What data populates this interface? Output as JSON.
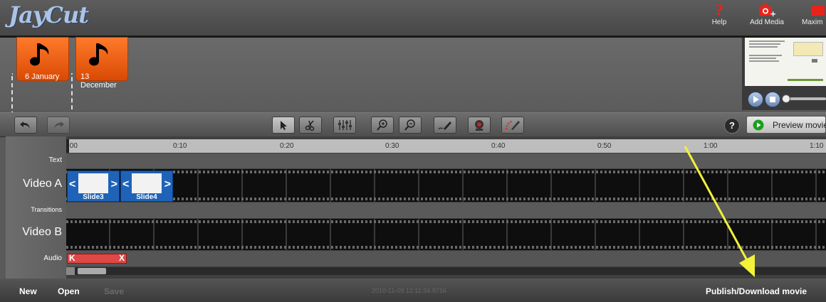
{
  "app": {
    "logo": "JayCut"
  },
  "header": {
    "help_label": "Help",
    "add_media_label": "Add Media",
    "maximize_label": "Maxim"
  },
  "media_bin": {
    "items": [
      {
        "label": "6 January",
        "icon": "music-note-icon"
      },
      {
        "label": "13 December",
        "icon": "music-note-icon"
      }
    ]
  },
  "toolbar": {
    "buttons": [
      "undo-icon",
      "redo-icon",
      "select-pointer-icon",
      "split-scissors-icon",
      "adjust-levels-icon",
      "zoom-in-icon",
      "zoom-out-icon",
      "pen-icon",
      "webcam-icon",
      "effects-brush-icon"
    ],
    "help_label": "?",
    "preview_label": "Preview movie"
  },
  "timeline": {
    "ticks": [
      ":00",
      "0:10",
      "0:20",
      "0:30",
      "0:40",
      "0:50",
      "1:00",
      "1:10"
    ],
    "tracks": {
      "text": "Text",
      "video_a": "Video A",
      "transitions": "Transitions",
      "video_b": "Video B",
      "audio": "Audio"
    },
    "clips": [
      "Slide3",
      "Slide4"
    ]
  },
  "bottom": {
    "new_label": "New",
    "open_label": "Open",
    "save_label": "Save",
    "timestamp": "2010-11-09 12:11:34.9716",
    "publish_label": "Publish/Download movie"
  },
  "colors": {
    "accent_orange": "#e85c12",
    "clip_blue": "#1e63b8",
    "arrow_yellow": "#f2f23a"
  }
}
